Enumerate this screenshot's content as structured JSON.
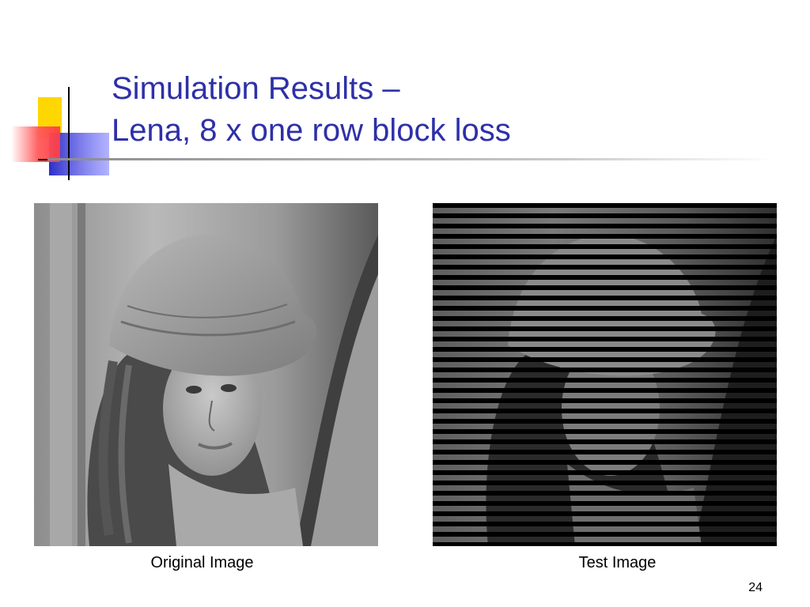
{
  "slide": {
    "title_line1": "Simulation Results –",
    "title_line2": "Lena, 8 x one row block loss",
    "page_number": "24"
  },
  "images": {
    "original": {
      "caption": "Original Image",
      "subject": "grayscale portrait"
    },
    "test": {
      "caption": "Test Image",
      "subject": "grayscale portrait with horizontal black row-loss stripes"
    }
  },
  "colors": {
    "title": "#2e30a8",
    "logo_yellow": "#ffd700",
    "logo_blue": "#3434c8",
    "logo_red": "#ff3b46",
    "rule_gray": "#9a9aa0"
  },
  "icons": [
    "slide-logo-icon"
  ]
}
